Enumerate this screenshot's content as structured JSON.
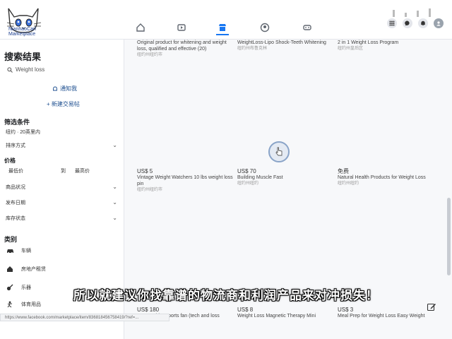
{
  "header": {
    "logo_text_line1": "NianhaoCarl",
    "logo_text_line2": "Marketplace",
    "nav_icons": [
      "home-icon",
      "video-icon",
      "marketplace-icon",
      "groups-icon",
      "gaming-icon"
    ],
    "right_icons": [
      "apps-icon",
      "messenger-icon",
      "notifications-icon",
      "profile-avatar"
    ]
  },
  "sidebar": {
    "title": "搜索结果",
    "search_value": "Weight loss",
    "notification_link": "通知我",
    "create_listing": "+ 新建交易帖",
    "filters_title": "筛选条件",
    "location": "纽约 · 20英里内",
    "sort_label": "排序方式",
    "price_label": "价格",
    "price_min": "最低价",
    "price_to": "到",
    "price_max": "最高价",
    "condition_label": "商品状况",
    "date_listed_label": "发布日期",
    "availability_label": "库存状态",
    "categories_title": "类别",
    "categories": [
      {
        "label": "车辆",
        "icon": "car-icon"
      },
      {
        "label": "房地产租赁",
        "icon": "house-icon"
      },
      {
        "label": "乐器",
        "icon": "guitar-icon"
      },
      {
        "label": "体育用品",
        "icon": "sports-icon"
      }
    ]
  },
  "listings": [
    {
      "price": "",
      "title": "Original product for whitening and weight loss, qualified and effective (20)",
      "location": "纽约州纽约市"
    },
    {
      "price": "",
      "title": "WeightLoss-Lipo Shock-Teeth Whitening",
      "location": "纽约州布鲁克林"
    },
    {
      "price": "",
      "title": "2 in 1 Weight Loss Program",
      "location": "纽约州皇后区"
    },
    {
      "price": "US$ 5",
      "title": "Vintage Weight Watchers 10 lbs weight loss pin",
      "location": "纽约州纽约市"
    },
    {
      "price": "US$ 70",
      "title": "Building Muscle Fast",
      "location": "纽约州纽约"
    },
    {
      "price": "免费",
      "title": "Natural Health Products for Weight Loss",
      "location": "纽约州纽约"
    },
    {
      "price": "US$ 180",
      "title": "...assembly! Sports fan (tech and loss",
      "location": ""
    },
    {
      "price": "US$ 8",
      "title": "Weight Loss Magnetic Therapy Mini",
      "location": ""
    },
    {
      "price": "US$ 3",
      "title": "Meal Prep for Weight Loss Easy Weight",
      "location": ""
    }
  ],
  "subtitle": "所以就建议你找靠谱的物流商和利润产品来对冲损失！",
  "status_url": "https://www.facebook.com/marketplace/item/836818456758419/?ref=..."
}
